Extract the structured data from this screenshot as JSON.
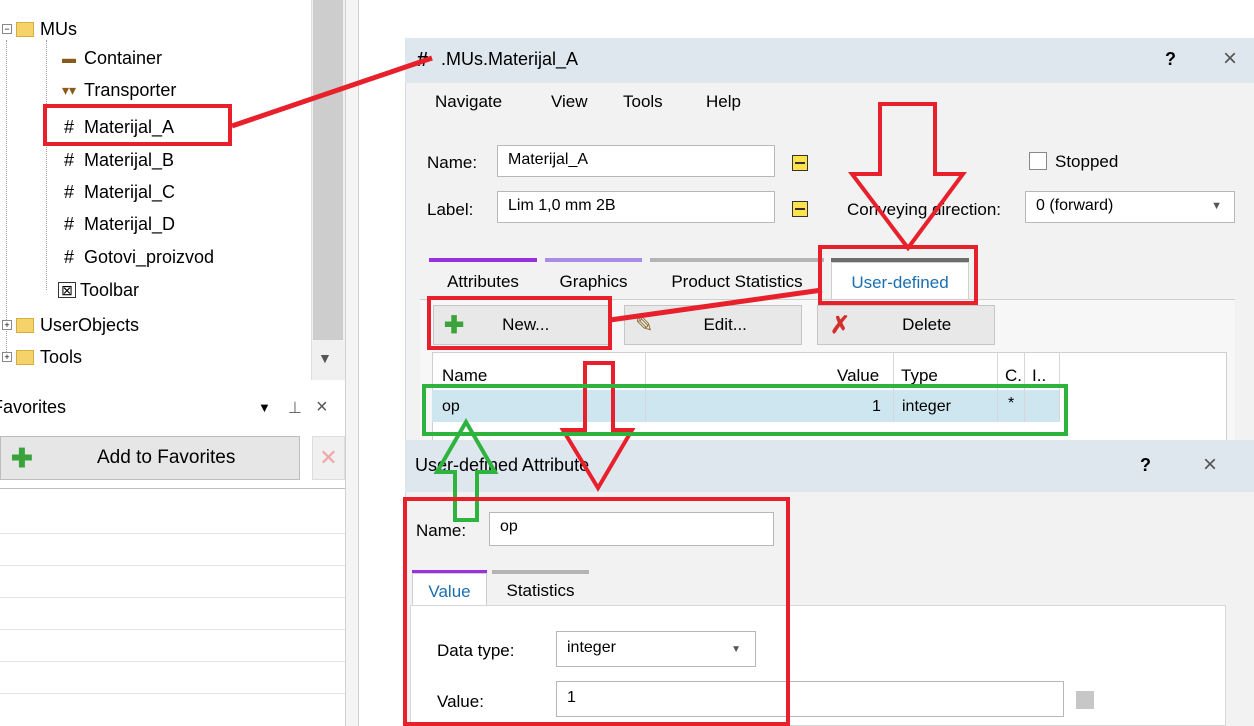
{
  "tree": {
    "items": [
      {
        "label": "MUs",
        "icon": "folder-icon"
      },
      {
        "label": "Container",
        "icon": "container-icon"
      },
      {
        "label": "Transporter",
        "icon": "transporter-icon"
      },
      {
        "label": "Materijal_A",
        "icon": "entity-hash-icon"
      },
      {
        "label": "Materijal_B",
        "icon": "entity-hash-icon"
      },
      {
        "label": "Materijal_C",
        "icon": "entity-hash-icon"
      },
      {
        "label": "Materijal_D",
        "icon": "entity-hash-icon"
      },
      {
        "label": "Gotovi_proizvod",
        "icon": "entity-hash-icon"
      },
      {
        "label": "Toolbar",
        "icon": "toolbar-icon"
      },
      {
        "label": "UserObjects",
        "icon": "folder-icon"
      },
      {
        "label": "Tools",
        "icon": "folder-icon"
      }
    ]
  },
  "favorites": {
    "title": "Favorites",
    "add_label": "Add to Favorites"
  },
  "main_window": {
    "title": ".MUs.Materijal_A",
    "help_glyph": "?",
    "close_glyph": "×",
    "menu": [
      "Navigate",
      "View",
      "Tools",
      "Help"
    ],
    "name_label": "Name:",
    "name_value": "Materijal_A",
    "label_label": "Label:",
    "label_value": "Lim 1,0 mm 2B",
    "stopped_label": "Stopped",
    "conveying_label": "Conveying direction:",
    "conveying_value": "0 (forward)",
    "tabs": [
      "Attributes",
      "Graphics",
      "Product Statistics",
      "User-defined"
    ],
    "buttons": {
      "new": "New...",
      "edit": "Edit...",
      "delete": "Delete"
    },
    "grid": {
      "columns": [
        "Name",
        "Value",
        "Type",
        "C.",
        "I.."
      ],
      "rows": [
        {
          "name": "op",
          "value": "1",
          "type": "integer",
          "c": "*",
          "i": ""
        }
      ]
    }
  },
  "dialog": {
    "title": "User-defined Attribute",
    "help_glyph": "?",
    "close_glyph": "×",
    "name_label": "Name:",
    "name_value": "op",
    "tabs": [
      "Value",
      "Statistics"
    ],
    "data_type_label": "Data type:",
    "data_type_value": "integer",
    "value_label": "Value:",
    "value_value": "1"
  },
  "colors": {
    "annotation_red": "#e8202c",
    "annotation_green": "#2fb33f",
    "tab_purple": "#9b30e0",
    "tab_lilac": "#a98be8",
    "tab_gray": "#b4b4b4",
    "titlebar": "#dfe7ee",
    "selected_row": "#cde6ef"
  }
}
